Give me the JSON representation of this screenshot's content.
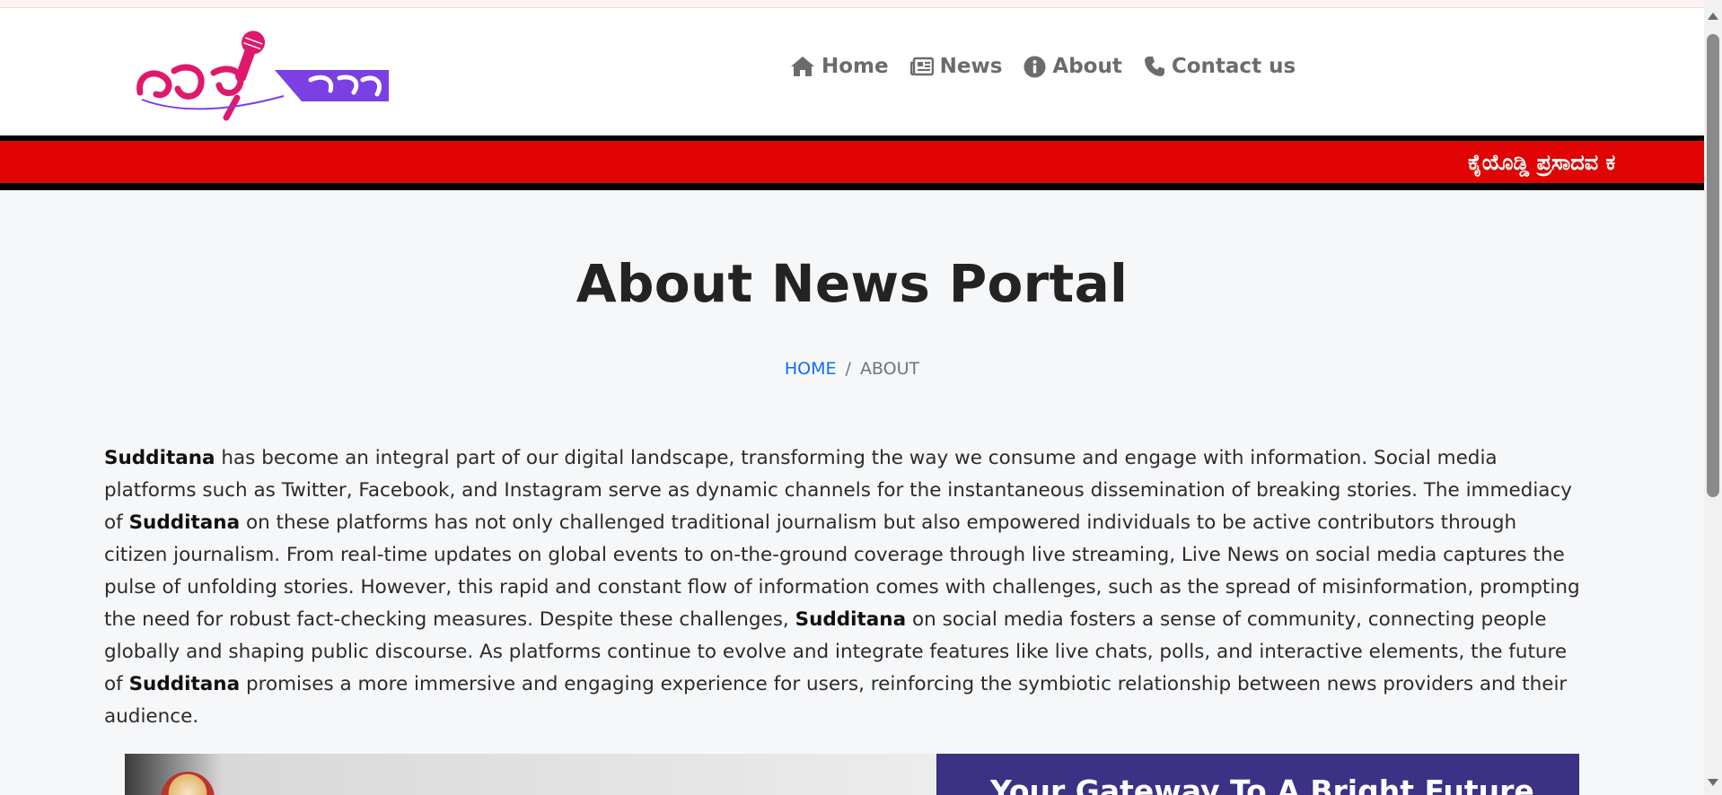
{
  "colors": {
    "ticker_bg": "#e00404",
    "nav_text": "#6b6b6b",
    "link_blue": "#0d6efd",
    "logo_pink": "#e0186c",
    "logo_purple": "#7b3fe4",
    "banner_purple": "#3b3185"
  },
  "nav": {
    "items": [
      {
        "label": "Home",
        "icon": "home-icon"
      },
      {
        "label": "News",
        "icon": "newspaper-icon"
      },
      {
        "label": "About",
        "icon": "info-icon"
      },
      {
        "label": "Contact us",
        "icon": "phone-icon"
      }
    ]
  },
  "ticker": {
    "text": "ಕೈಯೊಡ್ಡಿ ಪ್ರಸಾದವ ಕ"
  },
  "page": {
    "title": "About News Portal"
  },
  "breadcrumb": {
    "home": "HOME",
    "separator": "/",
    "current": "ABOUT"
  },
  "about": {
    "brand": "Sudditana",
    "p1": " has become an integral part of our digital landscape, transforming the way we consume and engage with information. Social media platforms such as Twitter, Facebook, and Instagram serve as dynamic channels for the instantaneous dissemination of breaking stories. The immediacy of ",
    "p2": " on these platforms has not only challenged traditional journalism but also empowered individuals to be active contributors through citizen journalism. From real-time updates on global events to on-the-ground coverage through live streaming, Live News on social media captures the pulse of unfolding stories. However, this rapid and constant flow of information comes with challenges, such as the spread of misinformation, prompting the need for robust fact-checking measures. Despite these challenges, ",
    "p3": " on social media fosters a sense of community, connecting people globally and shaping public discourse. As platforms continue to evolve and integrate features like live chats, polls, and interactive elements, the future of ",
    "p4": " promises a more immersive and engaging experience for users, reinforcing the symbiotic relationship between news providers and their audience."
  },
  "banner": {
    "right_text": "Your Gateway To A Bright Future"
  }
}
